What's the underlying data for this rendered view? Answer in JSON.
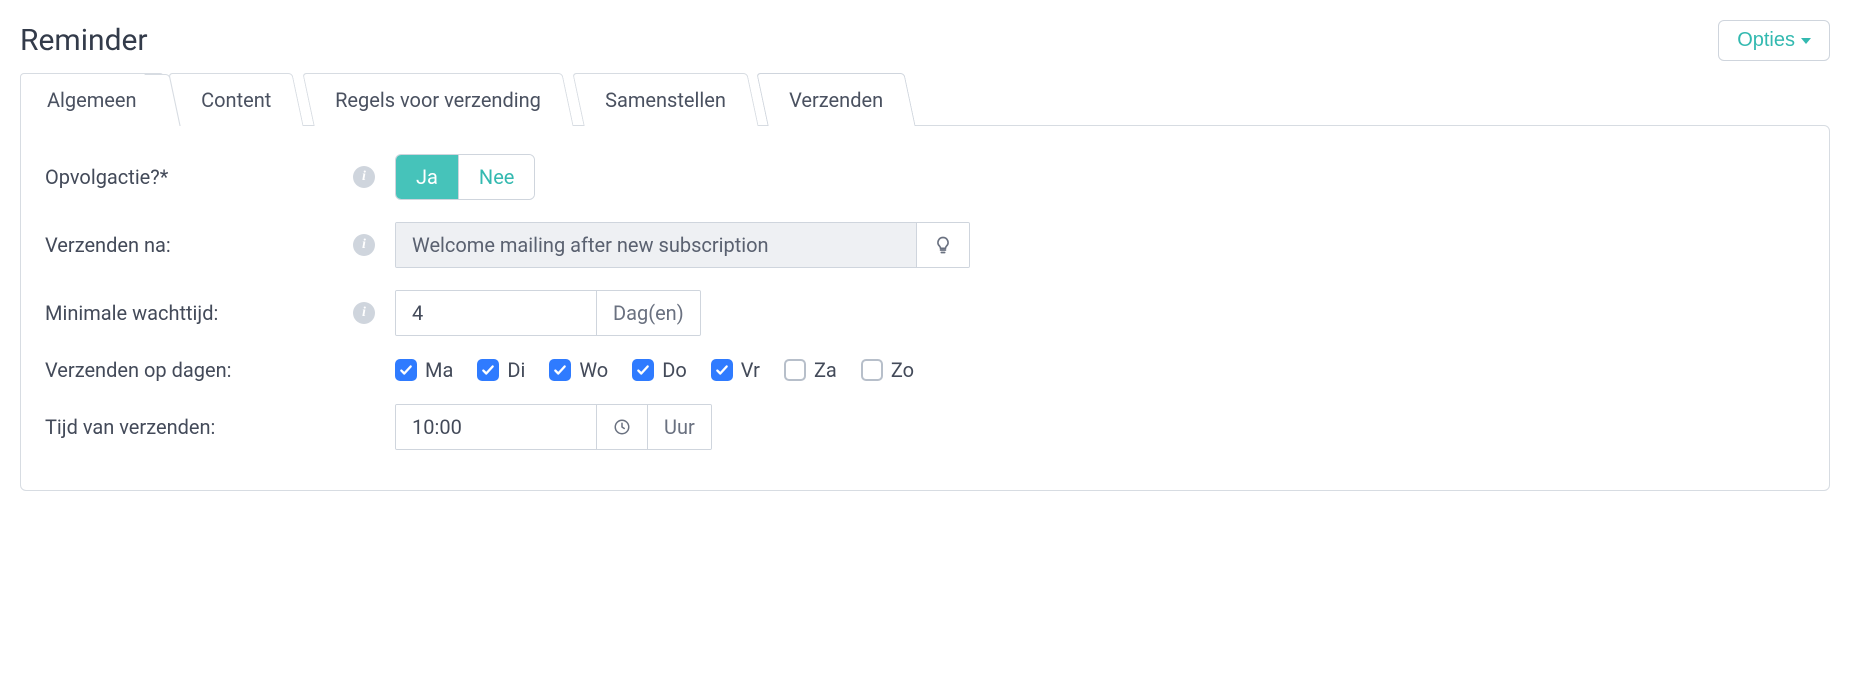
{
  "header": {
    "title": "Reminder",
    "options_label": "Opties"
  },
  "tabs": [
    {
      "label": "Algemeen"
    },
    {
      "label": "Content"
    },
    {
      "label": "Regels voor verzending"
    },
    {
      "label": "Samenstellen"
    },
    {
      "label": "Verzenden"
    }
  ],
  "active_tab": 4,
  "form": {
    "followup": {
      "label": "Opvolgactie?*",
      "yes": "Ja",
      "no": "Nee",
      "value": "Ja"
    },
    "send_after": {
      "label": "Verzenden na:",
      "value": "Welcome mailing after new subscription"
    },
    "min_wait": {
      "label": "Minimale wachttijd:",
      "value": "4",
      "unit": "Dag(en)"
    },
    "send_days": {
      "label": "Verzenden op dagen:",
      "days": [
        {
          "label": "Ma",
          "checked": true
        },
        {
          "label": "Di",
          "checked": true
        },
        {
          "label": "Wo",
          "checked": true
        },
        {
          "label": "Do",
          "checked": true
        },
        {
          "label": "Vr",
          "checked": true
        },
        {
          "label": "Za",
          "checked": false
        },
        {
          "label": "Zo",
          "checked": false
        }
      ]
    },
    "send_time": {
      "label": "Tijd van verzenden:",
      "value": "10:00",
      "unit": "Uur"
    }
  }
}
